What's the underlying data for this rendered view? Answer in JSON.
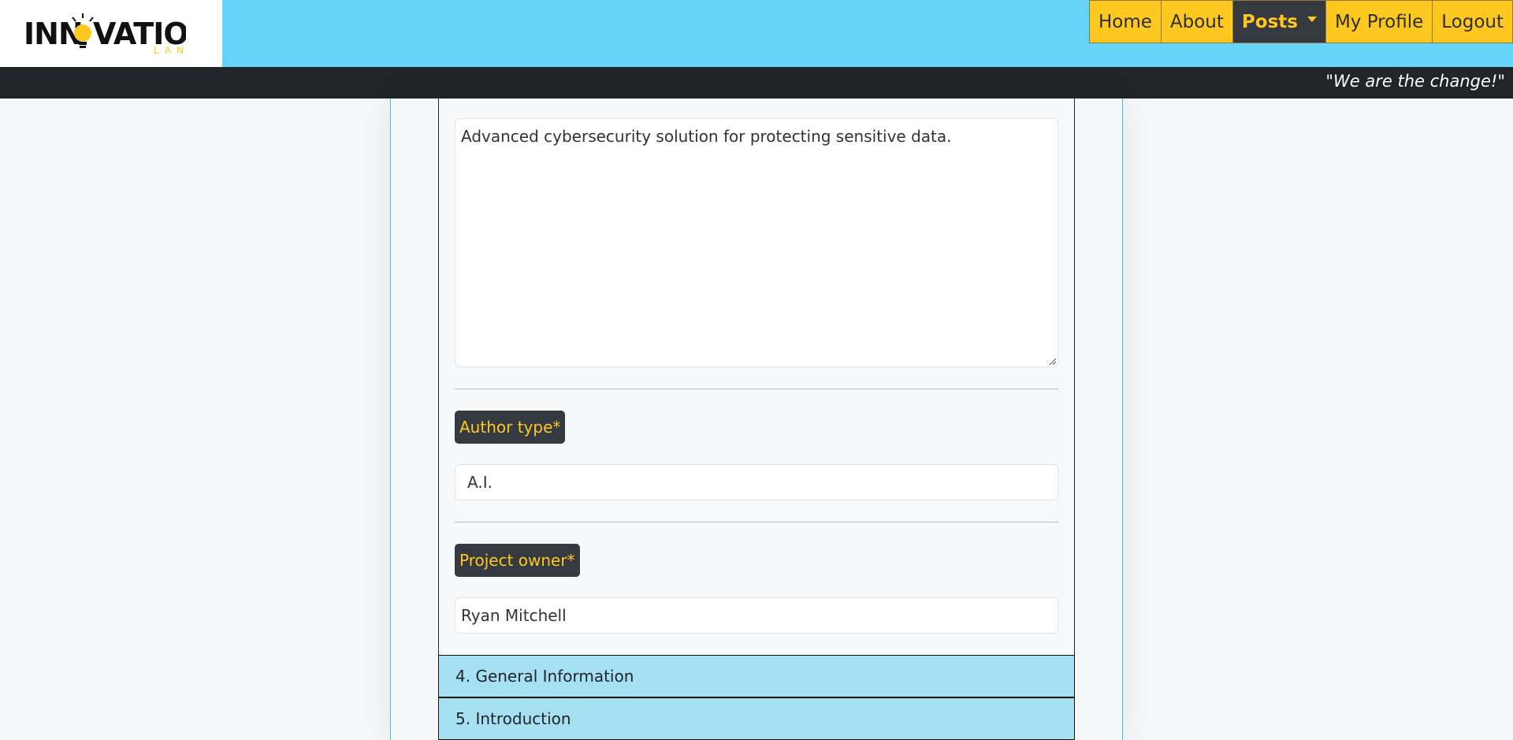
{
  "navbar": {
    "logo": {
      "text_main": "INNOVATION",
      "text_sub": "LAND"
    },
    "items": [
      {
        "label": "Home"
      },
      {
        "label": "About"
      },
      {
        "label": "Posts"
      },
      {
        "label": "My Profile"
      },
      {
        "label": "Logout"
      }
    ],
    "active_item": "Posts"
  },
  "slogan": "\"We are the change!\"",
  "form": {
    "description_value": "Advanced cybersecurity solution for protecting sensitive data.",
    "author_type": {
      "label": "Author type*",
      "value": "A.I."
    },
    "project_owner": {
      "label": "Project owner*",
      "value": "Ryan Mitchell"
    }
  },
  "accordion": {
    "sections": [
      {
        "title": "4. General Information"
      },
      {
        "title": "5. Introduction"
      }
    ]
  },
  "colors": {
    "navbar_bg": "#66d4f8",
    "nav_item_bg": "#ffc820",
    "nav_active_bg": "#343a40",
    "slogan_bar_bg": "#212529",
    "label_bg": "#343a40",
    "label_text": "#ffc820",
    "accordion_header_bg": "#a5e1f3"
  }
}
